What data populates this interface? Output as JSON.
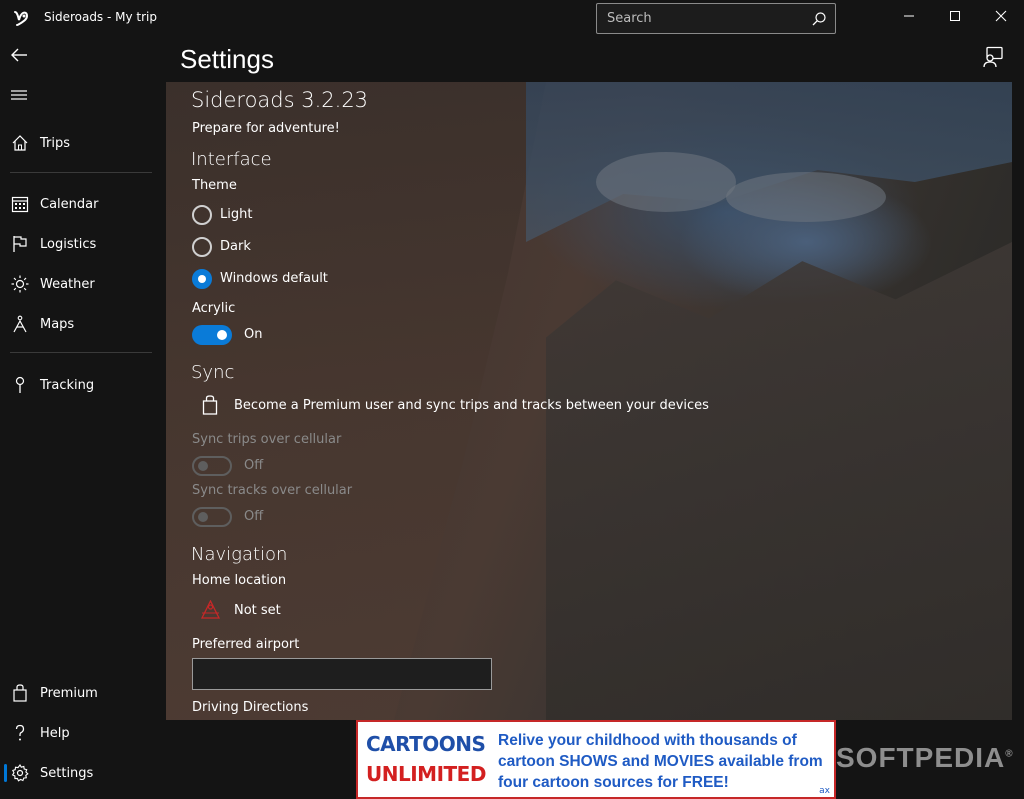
{
  "titlebar": {
    "app_title": "Sideroads - My trip",
    "search_placeholder": "Search"
  },
  "nav": {
    "items": [
      {
        "label": "Trips",
        "icon": "home-icon"
      },
      {
        "label": "Calendar",
        "icon": "calendar-icon"
      },
      {
        "label": "Logistics",
        "icon": "flag-icon"
      },
      {
        "label": "Weather",
        "icon": "sun-icon"
      },
      {
        "label": "Maps",
        "icon": "hiker-icon"
      },
      {
        "label": "Tracking",
        "icon": "pin-icon"
      },
      {
        "label": "Premium",
        "icon": "bag-icon"
      },
      {
        "label": "Help",
        "icon": "question-icon"
      },
      {
        "label": "Settings",
        "icon": "gear-icon"
      }
    ],
    "active": "Settings"
  },
  "page": {
    "title": "Settings"
  },
  "settings": {
    "app_version": "Sideroads 3.2.23",
    "tagline": "Prepare for adventure!",
    "interface": {
      "heading": "Interface",
      "theme_label": "Theme",
      "theme_options": [
        "Light",
        "Dark",
        "Windows default"
      ],
      "theme_selected": "Windows default",
      "acrylic_label": "Acrylic",
      "acrylic_state": "On"
    },
    "sync": {
      "heading": "Sync",
      "premium_message": "Become a Premium user and sync trips and tracks between your devices",
      "trips_label": "Sync trips over cellular",
      "trips_state": "Off",
      "tracks_label": "Sync tracks over cellular",
      "tracks_state": "Off"
    },
    "navigation": {
      "heading": "Navigation",
      "home_label": "Home location",
      "home_value": "Not set",
      "airport_label": "Preferred airport",
      "airport_value": "",
      "directions_label": "Driving Directions"
    }
  },
  "ad": {
    "logo_line1": "CARTOONS",
    "logo_line2": "UNLIMITED",
    "text": "Relive your childhood with thousands of cartoon SHOWS and MOVIES available from four cartoon sources for FREE!",
    "badge": "ax"
  },
  "watermark": "SOFTPEDIA",
  "colors": {
    "accent": "#0a7bd8",
    "background": "#141414",
    "ad_border": "#c62828"
  }
}
